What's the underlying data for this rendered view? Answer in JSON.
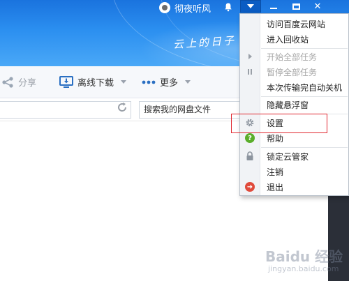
{
  "header": {
    "username": "彻夜听风",
    "slogan": "云上的日子"
  },
  "window_controls": [
    "menu-dropdown",
    "minimize",
    "maximize",
    "close"
  ],
  "toolbar": {
    "share_label": "分享",
    "offline_download_label": "离线下载",
    "more_label": "更多"
  },
  "search": {
    "placeholder": "搜索我的网盘文件"
  },
  "menu": {
    "items": [
      {
        "label": "访问百度云网站",
        "icon": "",
        "disabled": false
      },
      {
        "label": "进入回收站",
        "icon": "",
        "disabled": false
      },
      {
        "label": "开始全部任务",
        "icon": "play-icon",
        "disabled": true
      },
      {
        "label": "暂停全部任务",
        "icon": "pause-icon",
        "disabled": true
      },
      {
        "label": "本次传输完自动关机",
        "icon": "",
        "disabled": false
      },
      {
        "label": "隐藏悬浮窗",
        "icon": "",
        "disabled": false
      },
      {
        "label": "设置",
        "icon": "gear-icon",
        "disabled": false
      },
      {
        "label": "帮助",
        "icon": "help-icon",
        "disabled": false
      },
      {
        "label": "锁定云管家",
        "icon": "lock-icon",
        "disabled": false
      },
      {
        "label": "注销",
        "icon": "",
        "disabled": false
      },
      {
        "label": "退出",
        "icon": "exit-icon",
        "disabled": false
      }
    ]
  },
  "watermark": {
    "line1": "Baidu 经验",
    "line2": "jingyan.baidu.com"
  },
  "colors": {
    "header_blue": "#1a73de",
    "highlight_red": "#e0262e",
    "help_green": "#5aae2b",
    "exit_red": "#e04b3c"
  }
}
